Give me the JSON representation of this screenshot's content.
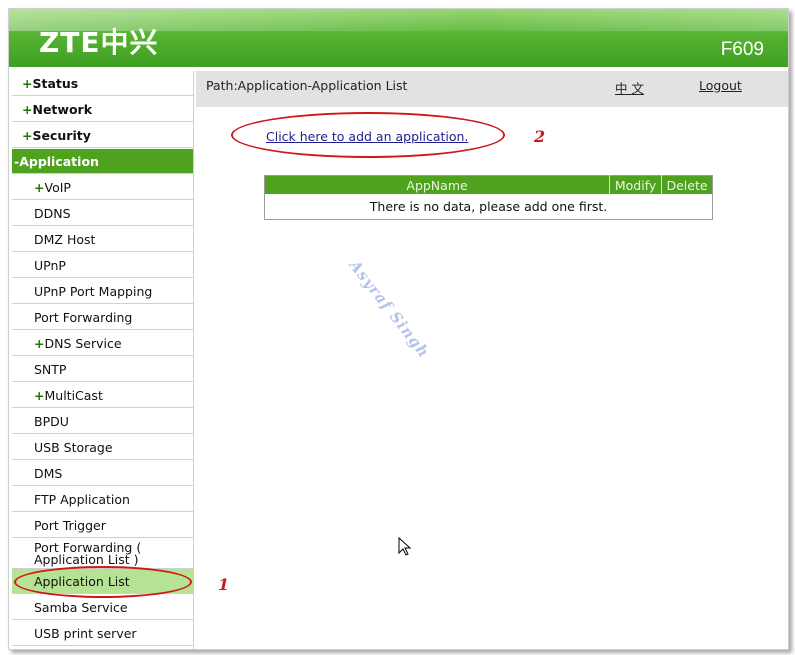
{
  "header": {
    "logo_text": "ZTE中兴",
    "model": "F609",
    "brand_color": "#4ea21e"
  },
  "sidebar": {
    "items": [
      {
        "prefix": "+",
        "label": "Status"
      },
      {
        "prefix": "+",
        "label": "Network"
      },
      {
        "prefix": "+",
        "label": "Security"
      },
      {
        "prefix": "-",
        "label": "Application"
      },
      {
        "prefix": "+",
        "label": "VoIP"
      },
      {
        "prefix": "",
        "label": "DDNS"
      },
      {
        "prefix": "",
        "label": "DMZ Host"
      },
      {
        "prefix": "",
        "label": "UPnP"
      },
      {
        "prefix": "",
        "label": "UPnP Port Mapping"
      },
      {
        "prefix": "",
        "label": "Port Forwarding"
      },
      {
        "prefix": "+",
        "label": "DNS Service"
      },
      {
        "prefix": "",
        "label": "SNTP"
      },
      {
        "prefix": "+",
        "label": "MultiCast"
      },
      {
        "prefix": "",
        "label": "BPDU"
      },
      {
        "prefix": "",
        "label": "USB Storage"
      },
      {
        "prefix": "",
        "label": "DMS"
      },
      {
        "prefix": "",
        "label": "FTP Application"
      },
      {
        "prefix": "",
        "label": "Port Trigger"
      },
      {
        "prefix": "",
        "label": "Port Forwarding (",
        "label_line2": "Application List )"
      },
      {
        "prefix": "",
        "label": "Application List"
      },
      {
        "prefix": "",
        "label": "Samba Service"
      },
      {
        "prefix": "",
        "label": "USB print server"
      }
    ]
  },
  "pathbar": {
    "path": "Path:Application-Application List",
    "language": "中 文",
    "logout": "Logout"
  },
  "main": {
    "add_link": "Click here to add an application.",
    "table": {
      "columns": [
        "AppName",
        "Modify",
        "Delete"
      ],
      "empty_message": "There is no data, please add one first."
    }
  },
  "annotations": {
    "label_1": "1",
    "label_2": "2",
    "color": "#d01818"
  },
  "watermark": "Asyraf Singh"
}
